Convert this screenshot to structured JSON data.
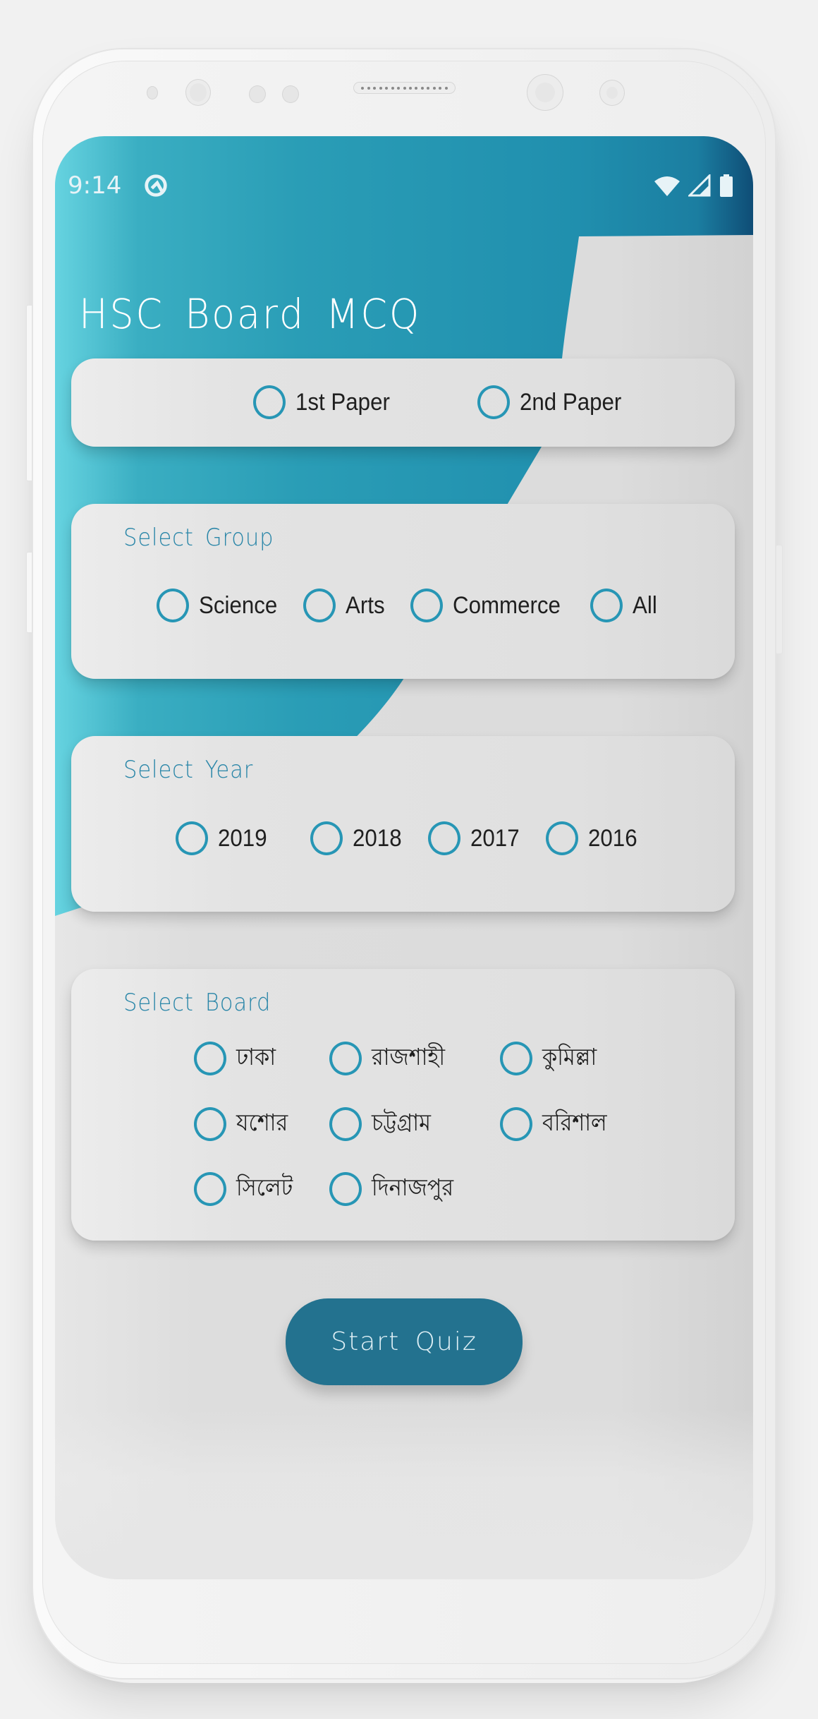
{
  "status_bar": {
    "time": "9:14",
    "left_icons": [
      "android-q-icon"
    ],
    "right_icons": [
      "wifi-icon",
      "cellular-signal-icon",
      "battery-icon"
    ]
  },
  "app": {
    "title": "HSC Board MCQ"
  },
  "colors": {
    "teal_light": "#5fd0de",
    "teal": "#2596b3",
    "teal_dark": "#0f4f78",
    "radio_ring": "#2796b5",
    "label_text": "#2a86a8",
    "button_bg": "#23728f",
    "card_bg": "#e3e3e3"
  },
  "paper": {
    "options": [
      {
        "label": "1st Paper",
        "selected": false
      },
      {
        "label": "2nd Paper",
        "selected": false
      }
    ]
  },
  "group": {
    "label": "Select Group",
    "options": [
      {
        "label": "Science",
        "selected": false
      },
      {
        "label": "Arts",
        "selected": false
      },
      {
        "label": "Commerce",
        "selected": false
      },
      {
        "label": "All",
        "selected": false
      }
    ]
  },
  "year": {
    "label": "Select Year",
    "options": [
      {
        "label": "2019",
        "selected": false
      },
      {
        "label": "2018",
        "selected": false
      },
      {
        "label": "2017",
        "selected": false
      },
      {
        "label": "2016",
        "selected": false
      }
    ]
  },
  "board": {
    "label": "Select Board",
    "options": [
      {
        "label": "ঢাকা",
        "selected": false
      },
      {
        "label": "রাজশাহী",
        "selected": false
      },
      {
        "label": "কুমিল্লা",
        "selected": false
      },
      {
        "label": "যশোর",
        "selected": false
      },
      {
        "label": "চট্টগ্রাম",
        "selected": false
      },
      {
        "label": "বরিশাল",
        "selected": false
      },
      {
        "label": "সিলেট",
        "selected": false
      },
      {
        "label": "দিনাজপুর",
        "selected": false
      }
    ]
  },
  "actions": {
    "start_label": "Start Quiz"
  }
}
